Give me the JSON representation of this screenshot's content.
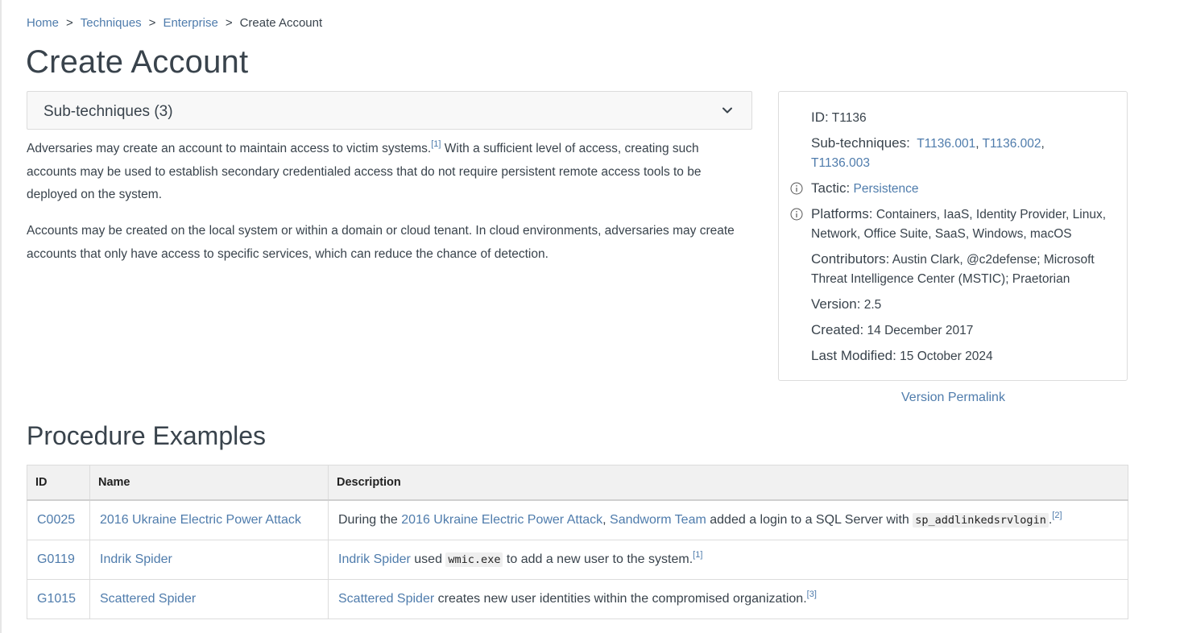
{
  "breadcrumb": {
    "items": [
      "Home",
      "Techniques",
      "Enterprise"
    ],
    "separator": ">",
    "current": "Create Account"
  },
  "page": {
    "title": "Create Account"
  },
  "subtechniques_toggle": {
    "label": "Sub-techniques (3)",
    "icon": "chevron-down-icon"
  },
  "description": {
    "p1_before": "Adversaries may create an account to maintain access to victim systems.",
    "p1_ref": "[1]",
    "p1_after": " With a sufficient level of access, creating such accounts may be used to establish secondary credentialed access that do not require persistent remote access tools to be deployed on the system.",
    "p2": "Accounts may be created on the local system or within a domain or cloud tenant. In cloud environments, adversaries may create accounts that only have access to specific services, which can reduce the chance of detection."
  },
  "info_card": {
    "id_label": "ID:",
    "id_value": "T1136",
    "subtech_label": "Sub-techniques:",
    "subtechs": [
      "T1136.001",
      "T1136.002",
      "T1136.003"
    ],
    "tactic_label": "Tactic:",
    "tactic_value": "Persistence",
    "platforms_label": "Platforms:",
    "platforms_value": "Containers, IaaS, Identity Provider, Linux, Network, Office Suite, SaaS, Windows, macOS",
    "contributors_label": "Contributors:",
    "contributors_value": "Austin Clark, @c2defense; Microsoft Threat Intelligence Center (MSTIC); Praetorian",
    "version_label": "Version:",
    "version_value": "2.5",
    "created_label": "Created:",
    "created_value": "14 December 2017",
    "modified_label": "Last Modified:",
    "modified_value": "15 October 2024"
  },
  "permalink": {
    "label": "Version Permalink"
  },
  "procedures": {
    "title": "Procedure Examples",
    "headers": [
      "ID",
      "Name",
      "Description"
    ],
    "rows": [
      {
        "id": "C0025",
        "name": "2016 Ukraine Electric Power Attack",
        "desc_pre": "During the ",
        "desc_link1": "2016 Ukraine Electric Power Attack",
        "desc_mid1": ", ",
        "desc_link2": "Sandworm Team",
        "desc_mid2": " added a login to a SQL Server with ",
        "desc_code": "sp_addlinkedsrvlogin",
        "desc_post": ".",
        "ref": "[2]"
      },
      {
        "id": "G0119",
        "name": "Indrik Spider",
        "desc_link1": "Indrik Spider",
        "desc_mid1": " used ",
        "desc_code": "wmic.exe",
        "desc_post": " to add a new user to the system.",
        "ref": "[1]"
      },
      {
        "id": "G1015",
        "name": "Scattered Spider",
        "desc_link1": "Scattered Spider",
        "desc_post": " creates new user identities within the compromised organization.",
        "ref": "[3]"
      }
    ]
  }
}
